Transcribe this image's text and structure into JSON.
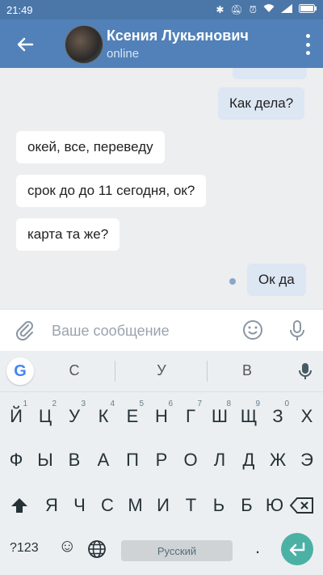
{
  "status": {
    "time": "21:49",
    "battery_level": 0.9
  },
  "header": {
    "contact_name": "Ксения Лукьянович",
    "contact_status": "online"
  },
  "messages": [
    {
      "text": "Как дела?",
      "direction": "out"
    },
    {
      "text": "окей, все, переведу",
      "direction": "in"
    },
    {
      "text": "срок до до 11 сегодня, ок?",
      "direction": "in"
    },
    {
      "text": "карта та же?",
      "direction": "in"
    },
    {
      "text": "Ок да",
      "direction": "out",
      "unread": true
    }
  ],
  "composer": {
    "placeholder": "Ваше сообщение"
  },
  "keyboard": {
    "suggestions": [
      "С",
      "У",
      "В"
    ],
    "row1": [
      "Й",
      "Ц",
      "У",
      "К",
      "Е",
      "Н",
      "Г",
      "Ш",
      "Щ",
      "З",
      "Х"
    ],
    "row1_hints": [
      "1",
      "2",
      "3",
      "4",
      "5",
      "6",
      "7",
      "8",
      "9",
      "0",
      ""
    ],
    "row2": [
      "Ф",
      "Ы",
      "В",
      "А",
      "П",
      "Р",
      "О",
      "Л",
      "Д",
      "Ж",
      "Э"
    ],
    "row3": [
      "Я",
      "Ч",
      "С",
      "М",
      "И",
      "Т",
      "Ь",
      "Б",
      "Ю"
    ],
    "symbols_label": "?123",
    "space_label": "Русский",
    "period_label": "."
  },
  "colors": {
    "header": "#5181b8",
    "chat_bg": "#edeef0",
    "out_bubble": "#dde6f3",
    "enter": "#4cb1a5"
  }
}
